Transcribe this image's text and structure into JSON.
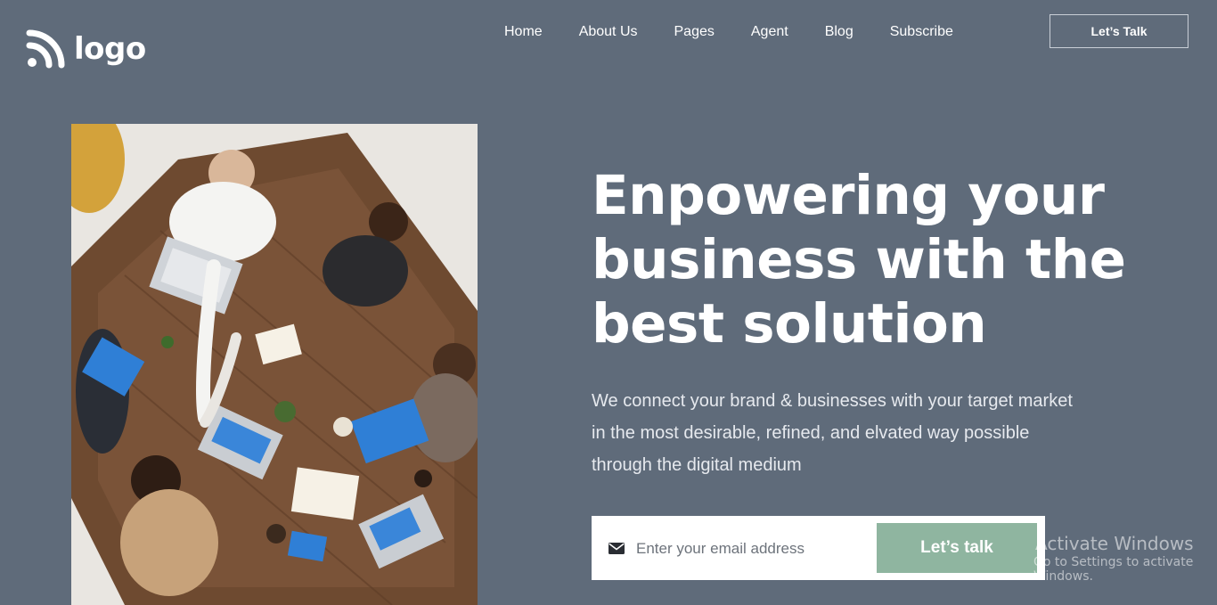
{
  "brand": {
    "logo_text": "logo"
  },
  "nav": {
    "items": [
      {
        "label": "Home"
      },
      {
        "label": "About Us"
      },
      {
        "label": "Pages"
      },
      {
        "label": "Agent"
      },
      {
        "label": "Blog"
      },
      {
        "label": "Subscribe"
      }
    ],
    "cta_label": "Let’s Talk"
  },
  "hero": {
    "headline": "Enpowering your business with the best solution",
    "subtext": "We connect your brand & businesses with your target market in the most desirable, refined, and elvated way possible through the digital medium",
    "image_icon": "team-meeting-photo"
  },
  "form": {
    "email_placeholder": "Enter your email address",
    "email_value": "",
    "submit_label": "Let’s talk",
    "mail_icon": "envelope-icon"
  },
  "watermark": {
    "title": "Activate Windows",
    "subtitle": "Go to Settings to activate Windows."
  },
  "colors": {
    "background": "#5f6b7a",
    "button_accent": "#8fb5a0",
    "text": "#ffffff"
  }
}
